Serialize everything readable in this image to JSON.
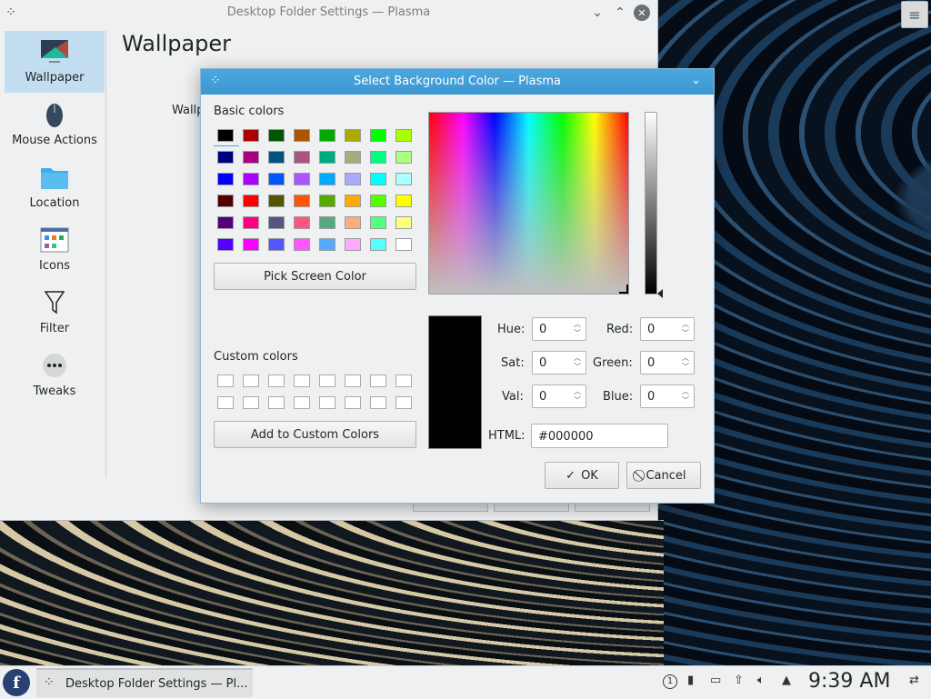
{
  "main_window": {
    "title": "Desktop Folder Settings — Plasma",
    "page_title": "Wallpaper",
    "wallpaper_label": "Wallp",
    "sidebar": [
      {
        "label": "Wallpaper",
        "icon": "monitor-icon"
      },
      {
        "label": "Mouse Actions",
        "icon": "mouse-icon"
      },
      {
        "label": "Location",
        "icon": "folder-icon"
      },
      {
        "label": "Icons",
        "icon": "icons-view-icon"
      },
      {
        "label": "Filter",
        "icon": "funnel-icon"
      },
      {
        "label": "Tweaks",
        "icon": "ellipsis-icon"
      }
    ]
  },
  "dialog": {
    "title": "Select Background Color — Plasma",
    "basic_colors_label": "Basic colors",
    "basic_colors": [
      [
        "#000000",
        "#aa0000",
        "#005500",
        "#aa5500",
        "#00aa00",
        "#aaaa00",
        "#00ff00",
        "#aaff00"
      ],
      [
        "#00007f",
        "#aa007f",
        "#00557f",
        "#aa557f",
        "#00aa7f",
        "#aaaa7f",
        "#00ff7f",
        "#aaff7f"
      ],
      [
        "#0000ff",
        "#aa00ff",
        "#0055ff",
        "#aa55ff",
        "#00aaff",
        "#aaaaff",
        "#00ffff",
        "#aaffff"
      ],
      [
        "#550000",
        "#ff0000",
        "#555500",
        "#ff5500",
        "#55aa00",
        "#ffaa00",
        "#55ff00",
        "#ffff00"
      ],
      [
        "#55007f",
        "#ff007f",
        "#55557f",
        "#ff557f",
        "#55aa7f",
        "#ffaa7f",
        "#55ff7f",
        "#ffff7f"
      ],
      [
        "#5500ff",
        "#ff00ff",
        "#5555ff",
        "#ff55ff",
        "#55aaff",
        "#ffaaff",
        "#55ffff",
        "#ffffff"
      ]
    ],
    "pick_screen_label": "Pick Screen Color",
    "custom_colors_label": "Custom colors",
    "add_custom_label": "Add to Custom Colors",
    "fields": {
      "hue_label": "Hue:",
      "hue": "0",
      "sat_label": "Sat:",
      "sat": "0",
      "val_label": "Val:",
      "val": "0",
      "red_label": "Red:",
      "red": "0",
      "green_label": "Green:",
      "green": "0",
      "blue_label": "Blue:",
      "blue": "0",
      "html_label": "HTML:",
      "html": "#000000"
    },
    "ok_label": "OK",
    "cancel_label": "Cancel",
    "current_color": "#000000"
  },
  "taskbar": {
    "task_label": "Desktop Folder Settings — Pl...",
    "clock": "9:39 AM",
    "notification_count": "1"
  }
}
